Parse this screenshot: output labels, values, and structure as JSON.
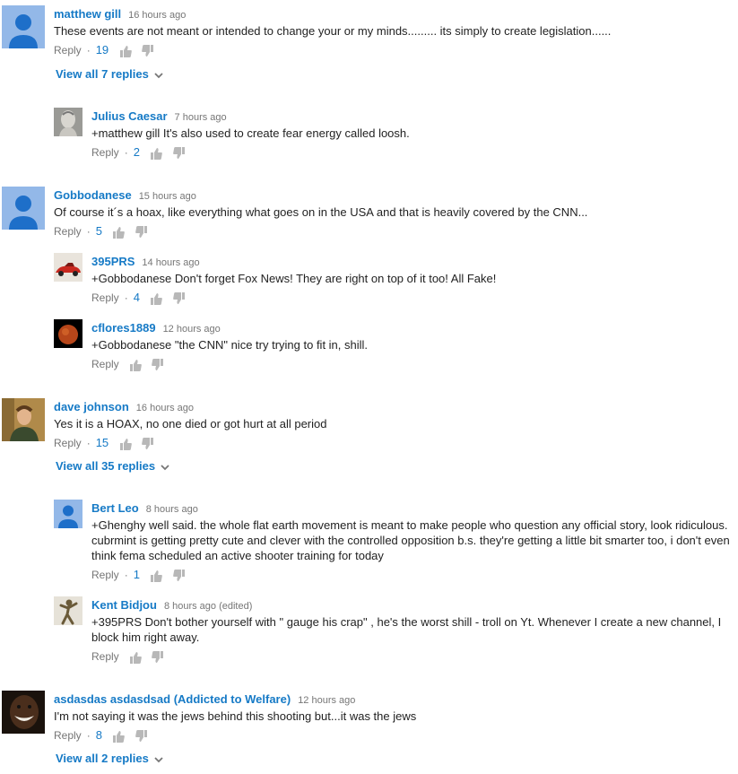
{
  "actions": {
    "reply_label": "Reply",
    "separator": "·"
  },
  "comments": [
    {
      "author": "matthew gill",
      "time": "16 hours ago",
      "text": "These events are not meant or intended to change your or my minds......... its simply to create legislation......",
      "likes": "19"
    },
    {
      "author": "Julius Caesar",
      "time": "7 hours ago",
      "text": "+matthew gill It's also used to create fear energy called loosh.",
      "likes": "2"
    },
    {
      "author": "Gobbodanese",
      "time": "15 hours ago",
      "text": "Of course it´s  a hoax, like everything what goes on in the USA and that is heavily covered by the CNN...",
      "likes": "5"
    },
    {
      "author": "395PRS",
      "time": "14 hours ago",
      "text": "+Gobbodanese  Don't forget Fox News!  They are right on top of it too!   All Fake!",
      "likes": "4"
    },
    {
      "author": "cflores1889",
      "time": "12 hours ago",
      "text": "+Gobbodanese \"the CNN\" nice try trying to fit in, shill.",
      "likes": ""
    },
    {
      "author": "dave johnson",
      "time": "16 hours ago",
      "text": "Yes it is a HOAX, no one died or got hurt at all period",
      "likes": "15"
    },
    {
      "author": "Bert Leo",
      "time": "8 hours ago",
      "text": "+Ghenghy  well said.  the whole flat earth movement is meant to make people who question any official story, look ridiculous.  cubrmint is getting pretty cute and clever with the controlled opposition b.s.      they're getting a little bit smarter too, i don't even think fema scheduled an active shooter training for today",
      "likes": "1"
    },
    {
      "author": "Kent Bidjou",
      "time": "8 hours ago (edited)",
      "text": "+395PRS Don't bother yourself with \" gauge his crap\" , he's the worst shill - troll on Yt. Whenever I create a new channel, I block him right away.",
      "likes": ""
    },
    {
      "author": "asdasdas asdasdsad (Addicted to Welfare)",
      "time": "12 hours ago",
      "text": "I'm not saying it was the jews behind this shooting but...it was the jews",
      "likes": "8"
    }
  ],
  "view_replies": [
    "View all 7 replies",
    "View all 35 replies",
    "View all 2 replies"
  ],
  "colors": {
    "link": "#167ac6",
    "meta": "#767676",
    "text": "#222222",
    "icon": "#b8b8b8",
    "default_avatar_bg": "#93b8e8"
  },
  "icons": [
    "thumbs-up-icon",
    "thumbs-down-icon",
    "chevron-down-icon",
    "default-avatar-icon"
  ]
}
